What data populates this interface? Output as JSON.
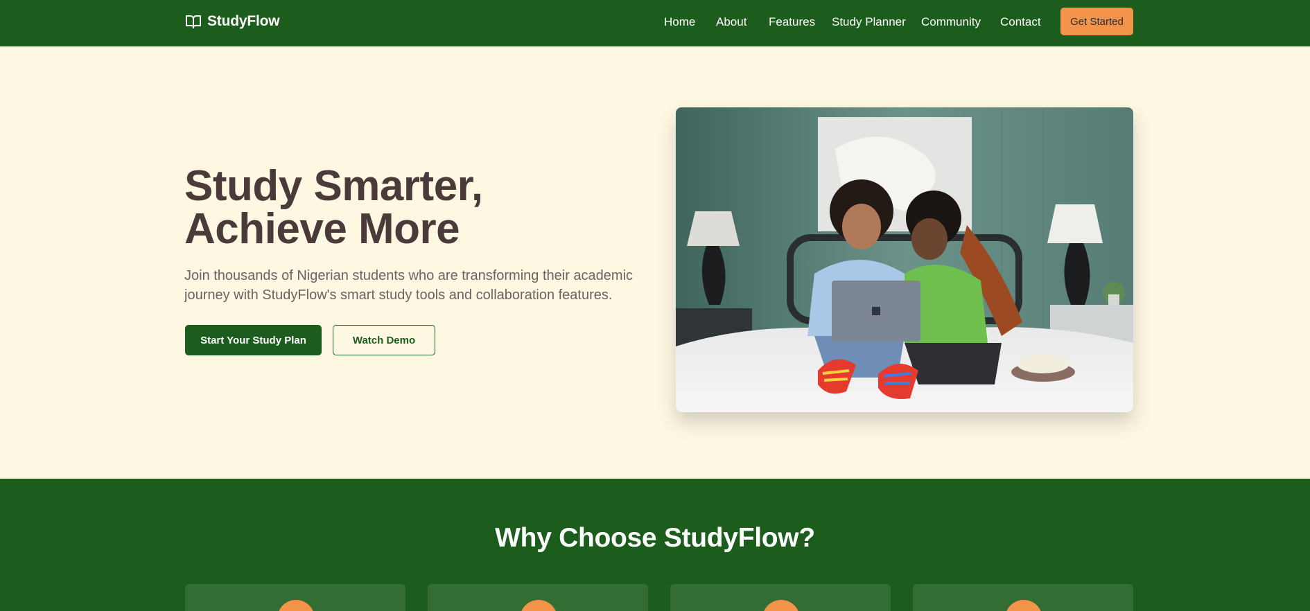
{
  "brand": {
    "name": "StudyFlow",
    "icon": "open-book-icon"
  },
  "nav": {
    "links": [
      "Home",
      "About",
      "Features",
      "Study Planner",
      "Community",
      "Contact"
    ],
    "cta_label": "Get Started"
  },
  "hero": {
    "title_line1": "Study Smarter,",
    "title_line2": "Achieve More",
    "subtitle": "Join thousands of Nigerian students who are transforming their academic journey with StudyFlow's smart study tools and collaboration features.",
    "primary_button": "Start Your Study Plan",
    "secondary_button": "Watch Demo",
    "image_subject": "two students on a bed looking at a laptop"
  },
  "features": {
    "title": "Why Choose StudyFlow?"
  },
  "colors": {
    "primary_green": "#1c5c1c",
    "card_green": "#336d33",
    "accent_orange": "#f4934a",
    "hero_bg": "#fef8e3",
    "heading_text": "#4a3a3a",
    "body_text": "#6c6262"
  }
}
